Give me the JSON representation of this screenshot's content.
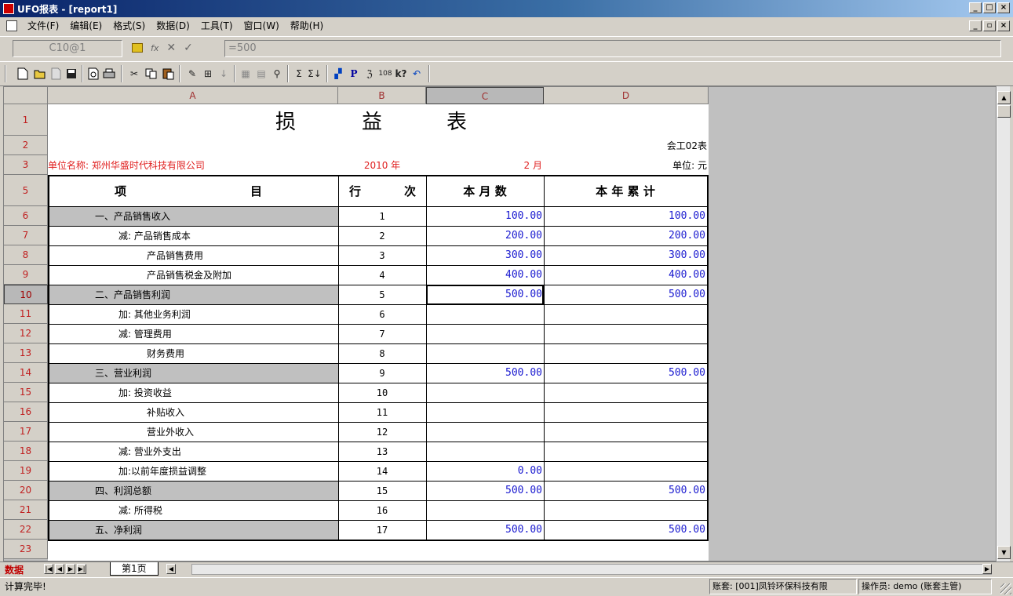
{
  "window": {
    "title": "UFO报表 - [report1]",
    "btn_min": "_",
    "btn_max": "□",
    "btn_close": "×",
    "mdi_min": "_",
    "mdi_restore": "▫",
    "mdi_close": "×"
  },
  "menu": [
    "文件(F)",
    "编辑(E)",
    "格式(S)",
    "数据(D)",
    "工具(T)",
    "窗口(W)",
    "帮助(H)"
  ],
  "formula_bar": {
    "cell_ref": "C10@1",
    "formula": "=500",
    "fx": "fx",
    "cancel": "✕",
    "accept": "✓"
  },
  "toolbar_icons": [
    "new-icon",
    "open-icon",
    "close-doc-icon",
    "save-icon",
    "print-preview-icon",
    "print-icon",
    "cut-icon",
    "copy-icon",
    "paste-icon",
    "format-brush-icon",
    "insert-icon",
    "sort-icon",
    "merge-icon",
    "split-icon",
    "find-icon",
    "sum-icon",
    "subtotal-icon",
    "chart-icon",
    "page-icon",
    "calc-icon",
    "data-icon",
    "help-icon",
    "undo-icon"
  ],
  "toolbar_glyphs": {
    "p": "P",
    "sigma": "Σ",
    "sigma2": "Σ↓",
    "bin": "108",
    "help": "k?",
    "undo": "↶"
  },
  "columns": [
    "A",
    "B",
    "C",
    "D"
  ],
  "rows": [
    "1",
    "2",
    "3",
    "5",
    "6",
    "7",
    "8",
    "9",
    "10",
    "11",
    "12",
    "13",
    "14",
    "15",
    "16",
    "17",
    "18",
    "19",
    "20",
    "21",
    "22",
    "23"
  ],
  "report": {
    "title_chars": [
      "损",
      "益",
      "表"
    ],
    "form_code": "会工02表",
    "unit_name": "单位名称: 郑州华盛时代科技有限公司",
    "year": "2010 年",
    "month": "2 月",
    "unit": "单位: 元",
    "headers": {
      "item_a": "项",
      "item_b": "目",
      "line_a": "行",
      "line_b": "次",
      "month_total": "本 月 数",
      "year_total": "本 年 累 计"
    },
    "items": [
      {
        "name": "一、产品销售收入",
        "line": "1",
        "month": "100.00",
        "year": "100.00"
      },
      {
        "name": "减: 产品销售成本",
        "line": "2",
        "month": "200.00",
        "year": "200.00"
      },
      {
        "name": "产品销售费用",
        "line": "3",
        "month": "300.00",
        "year": "300.00"
      },
      {
        "name": "产品销售税金及附加",
        "line": "4",
        "month": "400.00",
        "year": "400.00"
      },
      {
        "name": "二、产品销售利润",
        "line": "5",
        "month": "500.00",
        "year": "500.00"
      },
      {
        "name": "加: 其他业务利润",
        "line": "6",
        "month": "",
        "year": ""
      },
      {
        "name": "减: 管理费用",
        "line": "7",
        "month": "",
        "year": ""
      },
      {
        "name": "财务费用",
        "line": "8",
        "month": "",
        "year": ""
      },
      {
        "name": "三、营业利润",
        "line": "9",
        "month": "500.00",
        "year": "500.00"
      },
      {
        "name": "加: 投资收益",
        "line": "10",
        "month": "",
        "year": ""
      },
      {
        "name": "补贴收入",
        "line": "11",
        "month": "",
        "year": ""
      },
      {
        "name": "营业外收入",
        "line": "12",
        "month": "",
        "year": ""
      },
      {
        "name": "减: 营业外支出",
        "line": "13",
        "month": "",
        "year": ""
      },
      {
        "name": "加:以前年度损益调整",
        "line": "14",
        "month": "0.00",
        "year": ""
      },
      {
        "name": "四、利润总额",
        "line": "15",
        "month": "500.00",
        "year": "500.00"
      },
      {
        "name": "减: 所得税",
        "line": "16",
        "month": "",
        "year": ""
      },
      {
        "name": "五、净利润",
        "line": "17",
        "month": "500.00",
        "year": "500.00"
      }
    ]
  },
  "tabs": {
    "mode": "数据",
    "sheet": "第1页"
  },
  "status": {
    "message": "计算完毕!",
    "account": "账套: [001]凤铃环保科技有限",
    "operator": "操作员: demo (账套主管)"
  }
}
